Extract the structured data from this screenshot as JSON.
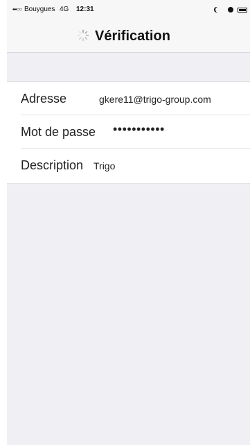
{
  "status_bar": {
    "signal": "•••○○",
    "carrier": "Bouygues",
    "network": "4G",
    "time": "12:31"
  },
  "header": {
    "title": "Vérification",
    "loading_icon": "spinner-icon"
  },
  "form": {
    "fields": [
      {
        "label": "Adresse",
        "value": "gkere11@trigo-group.com"
      },
      {
        "label": "Mot de passe",
        "value": "•••••••••••"
      },
      {
        "label": "Description",
        "value": "Trigo"
      }
    ]
  },
  "colors": {
    "background": "#efeff4",
    "header_background": "#f7f7f7",
    "card_background": "#ffffff",
    "text": "#111111",
    "divider": "#e3e3e7"
  }
}
